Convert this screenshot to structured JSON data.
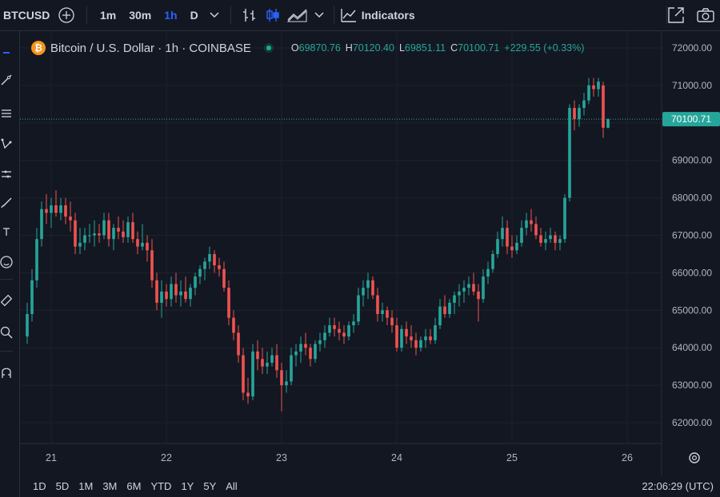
{
  "toolbar": {
    "symbol": "BTCUSD",
    "intervals": [
      "1m",
      "30m",
      "1h",
      "D"
    ],
    "active_interval": "1h",
    "indicators_label": "Indicators"
  },
  "legend": {
    "title": "Bitcoin / U.S. Dollar · 1h · COINBASE",
    "logo_glyph": "₿",
    "o_label": "O",
    "o_value": "69870.76",
    "h_label": "H",
    "h_value": "70120.40",
    "l_label": "L",
    "l_value": "69851.11",
    "c_label": "C",
    "c_value": "70100.71",
    "change": "+229.55 (+0.33%)"
  },
  "price_label": "70100.71",
  "bottom": {
    "ranges": [
      "1D",
      "5D",
      "1M",
      "3M",
      "6M",
      "YTD",
      "1Y",
      "5Y",
      "All"
    ],
    "clock": "22:06:29 (UTC)"
  },
  "colors": {
    "up": "#26a69a",
    "down": "#ef5350",
    "bg": "#131722",
    "grid": "#1e222d",
    "accent": "#2962ff"
  },
  "icons": [
    "plus-circle-icon",
    "chevron-down-icon",
    "bar-chart-icon",
    "candles-icon",
    "area-chart-icon",
    "indicators-icon",
    "fullscreen-icon",
    "camera-icon",
    "settings-icon"
  ],
  "chart_data": {
    "type": "candlestick",
    "x_unit": "hour index (0 = 2024-05-21 00:00 UTC approx.)",
    "ylim": [
      61500,
      72250
    ],
    "y_ticks": [
      62000,
      63000,
      64000,
      65000,
      66000,
      67000,
      68000,
      69000,
      70000,
      71000,
      72000
    ],
    "y_tick_labels": [
      "62000.00",
      "63000.00",
      "64000.00",
      "65000.00",
      "66000.00",
      "67000.00",
      "68000.00",
      "69000.00",
      "70000.00",
      "71000.00",
      "72000.00"
    ],
    "x_tick_labels": [
      "21",
      "22",
      "23",
      "24",
      "25",
      "26"
    ],
    "last_price": 70100.71,
    "candles": [
      [
        64300,
        65200,
        64100,
        64900
      ],
      [
        64900,
        66100,
        64700,
        65800
      ],
      [
        65800,
        67200,
        65600,
        66900
      ],
      [
        66900,
        67900,
        66700,
        67700
      ],
      [
        67700,
        68100,
        67300,
        67600
      ],
      [
        67600,
        68000,
        67200,
        67800
      ],
      [
        67800,
        68200,
        67500,
        67600
      ],
      [
        67600,
        68000,
        67400,
        67800
      ],
      [
        67800,
        68000,
        67300,
        67500
      ],
      [
        67500,
        67900,
        67100,
        67400
      ],
      [
        67400,
        67600,
        66500,
        66700
      ],
      [
        66700,
        67200,
        66500,
        66800
      ],
      [
        66800,
        67200,
        66600,
        67000
      ],
      [
        67000,
        67300,
        66800,
        67000
      ],
      [
        67000,
        67400,
        66700,
        67050
      ],
      [
        67050,
        67300,
        66800,
        67000
      ],
      [
        67000,
        67600,
        66900,
        67400
      ],
      [
        67400,
        67600,
        66700,
        66900
      ],
      [
        66900,
        67300,
        66600,
        67200
      ],
      [
        67200,
        67500,
        66900,
        67100
      ],
      [
        67100,
        67400,
        66800,
        66950
      ],
      [
        66950,
        67500,
        66800,
        67350
      ],
      [
        67350,
        67600,
        66800,
        66900
      ],
      [
        66900,
        67100,
        66500,
        66700
      ],
      [
        66700,
        67300,
        66600,
        66800
      ],
      [
        66800,
        67000,
        66300,
        66600
      ],
      [
        66600,
        66900,
        65600,
        65800
      ],
      [
        65800,
        66000,
        65000,
        65200
      ],
      [
        65200,
        65800,
        64800,
        65500
      ],
      [
        65500,
        65700,
        65100,
        65300
      ],
      [
        65300,
        65900,
        65100,
        65700
      ],
      [
        65700,
        66000,
        65200,
        65400
      ],
      [
        65400,
        65800,
        65100,
        65500
      ],
      [
        65500,
        65900,
        65200,
        65300
      ],
      [
        65300,
        65700,
        65100,
        65600
      ],
      [
        65600,
        66000,
        65400,
        65900
      ],
      [
        65900,
        66200,
        65700,
        66100
      ],
      [
        66100,
        66400,
        65800,
        66300
      ],
      [
        66300,
        66700,
        66100,
        66500
      ],
      [
        66500,
        66600,
        66000,
        66200
      ],
      [
        66200,
        66400,
        65900,
        66100
      ],
      [
        66100,
        66300,
        65500,
        65600
      ],
      [
        65600,
        65800,
        64600,
        64800
      ],
      [
        64800,
        65000,
        64200,
        64400
      ],
      [
        64400,
        64600,
        63600,
        63800
      ],
      [
        63800,
        64000,
        62600,
        62800
      ],
      [
        62800,
        63200,
        62500,
        62700
      ],
      [
        62700,
        64100,
        62600,
        63900
      ],
      [
        63900,
        64200,
        63400,
        63700
      ],
      [
        63700,
        64000,
        63300,
        63500
      ],
      [
        63500,
        63900,
        63300,
        63600
      ],
      [
        63600,
        64000,
        63500,
        63800
      ],
      [
        63800,
        64100,
        63200,
        63400
      ],
      [
        63400,
        63600,
        62300,
        63000
      ],
      [
        63000,
        63400,
        62800,
        63100
      ],
      [
        63100,
        64000,
        63000,
        63800
      ],
      [
        63800,
        64100,
        63500,
        63900
      ],
      [
        63900,
        64300,
        63600,
        64100
      ],
      [
        64100,
        64400,
        63800,
        64000
      ],
      [
        64000,
        64100,
        63500,
        63700
      ],
      [
        63700,
        64200,
        63600,
        64100
      ],
      [
        64100,
        64400,
        63900,
        64200
      ],
      [
        64200,
        64600,
        64000,
        64400
      ],
      [
        64400,
        64800,
        64300,
        64600
      ],
      [
        64600,
        64800,
        64300,
        64500
      ],
      [
        64500,
        64700,
        64200,
        64400
      ],
      [
        64400,
        64600,
        64100,
        64300
      ],
      [
        64300,
        64700,
        64200,
        64600
      ],
      [
        64600,
        64900,
        64400,
        64700
      ],
      [
        64700,
        65600,
        64600,
        65400
      ],
      [
        65400,
        65800,
        65100,
        65600
      ],
      [
        65600,
        66000,
        65300,
        65800
      ],
      [
        65800,
        65900,
        65300,
        65400
      ],
      [
        65400,
        65600,
        64700,
        64900
      ],
      [
        64900,
        65200,
        64700,
        65000
      ],
      [
        65000,
        65100,
        64600,
        64800
      ],
      [
        64800,
        65000,
        64400,
        64600
      ],
      [
        64600,
        64800,
        63900,
        64000
      ],
      [
        64000,
        64600,
        63900,
        64500
      ],
      [
        64500,
        64700,
        64100,
        64300
      ],
      [
        64300,
        64600,
        64000,
        64200
      ],
      [
        64200,
        64400,
        63800,
        64000
      ],
      [
        64000,
        64300,
        63900,
        64200
      ],
      [
        64200,
        64500,
        64000,
        64300
      ],
      [
        64300,
        64500,
        64100,
        64200
      ],
      [
        64200,
        64800,
        64100,
        64600
      ],
      [
        64600,
        65300,
        64500,
        65100
      ],
      [
        65100,
        65400,
        64800,
        64900
      ],
      [
        64900,
        65300,
        64800,
        65200
      ],
      [
        65200,
        65500,
        64900,
        65400
      ],
      [
        65400,
        65700,
        65100,
        65500
      ],
      [
        65500,
        65800,
        65200,
        65600
      ],
      [
        65600,
        65900,
        65400,
        65700
      ],
      [
        65700,
        66000,
        65400,
        65500
      ],
      [
        65500,
        65700,
        64700,
        65300
      ],
      [
        65300,
        66100,
        65200,
        65900
      ],
      [
        65900,
        66300,
        65700,
        66100
      ],
      [
        66100,
        66600,
        66000,
        66500
      ],
      [
        66500,
        67100,
        66400,
        66900
      ],
      [
        66900,
        67500,
        66700,
        67200
      ],
      [
        67200,
        67400,
        66500,
        66700
      ],
      [
        66700,
        67000,
        66400,
        66600
      ],
      [
        66600,
        67000,
        66500,
        66800
      ],
      [
        66800,
        67400,
        66700,
        67200
      ],
      [
        67200,
        67600,
        67000,
        67400
      ],
      [
        67400,
        67700,
        67100,
        67300
      ],
      [
        67300,
        67500,
        66900,
        67000
      ],
      [
        67000,
        67200,
        66700,
        66800
      ],
      [
        66800,
        67100,
        66600,
        66900
      ],
      [
        66900,
        67200,
        66800,
        67000
      ],
      [
        67000,
        67100,
        66600,
        66800
      ],
      [
        66800,
        67000,
        66600,
        66900
      ],
      [
        66900,
        68100,
        66800,
        68000
      ],
      [
        68000,
        70500,
        67900,
        70400
      ],
      [
        70400,
        70600,
        69800,
        70100
      ],
      [
        70100,
        70500,
        69900,
        70400
      ],
      [
        70400,
        70800,
        70200,
        70600
      ],
      [
        70600,
        71200,
        70500,
        71000
      ],
      [
        71000,
        71200,
        70700,
        70900
      ],
      [
        70900,
        71200,
        70700,
        71100
      ],
      [
        71000,
        71100,
        69600,
        69870.76
      ],
      [
        69870.76,
        70120.4,
        69851.11,
        70100.71
      ]
    ]
  }
}
